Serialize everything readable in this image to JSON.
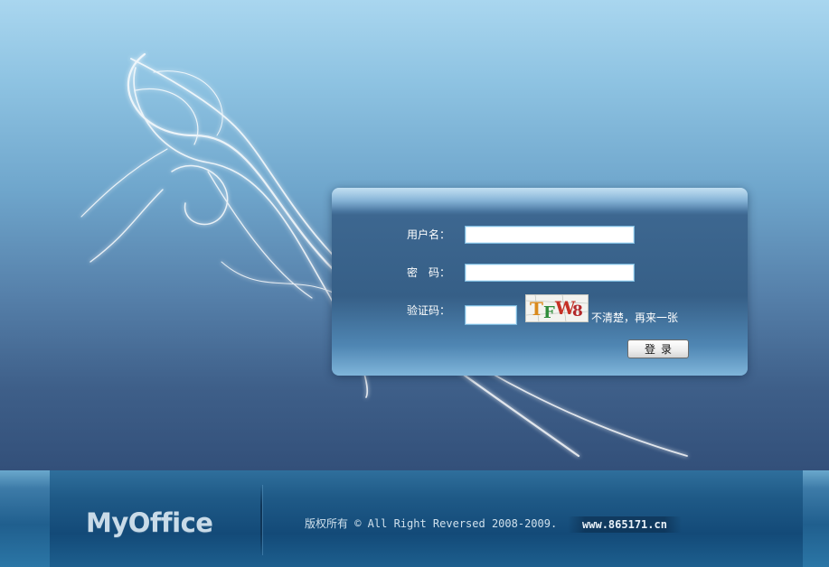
{
  "login": {
    "username_label": "用户名：",
    "password_label": "密　码：",
    "captcha_label": "验证码：",
    "username_value": "",
    "password_value": "",
    "captcha_value": "",
    "captcha_text": "TFW8",
    "captcha_refresh_label": "不清楚，再来一张",
    "submit_label": "登录"
  },
  "footer": {
    "brand": "MyOffice",
    "copyright": "版权所有 © All Right Reversed 2008-2009.",
    "site_url": "www.865171.cn"
  },
  "colors": {
    "background_top": "#a9d6ef",
    "background_bottom": "#33507a",
    "panel": "#365f87",
    "footer": "#134a78"
  },
  "icons": {
    "decoration": "light-streaks"
  }
}
